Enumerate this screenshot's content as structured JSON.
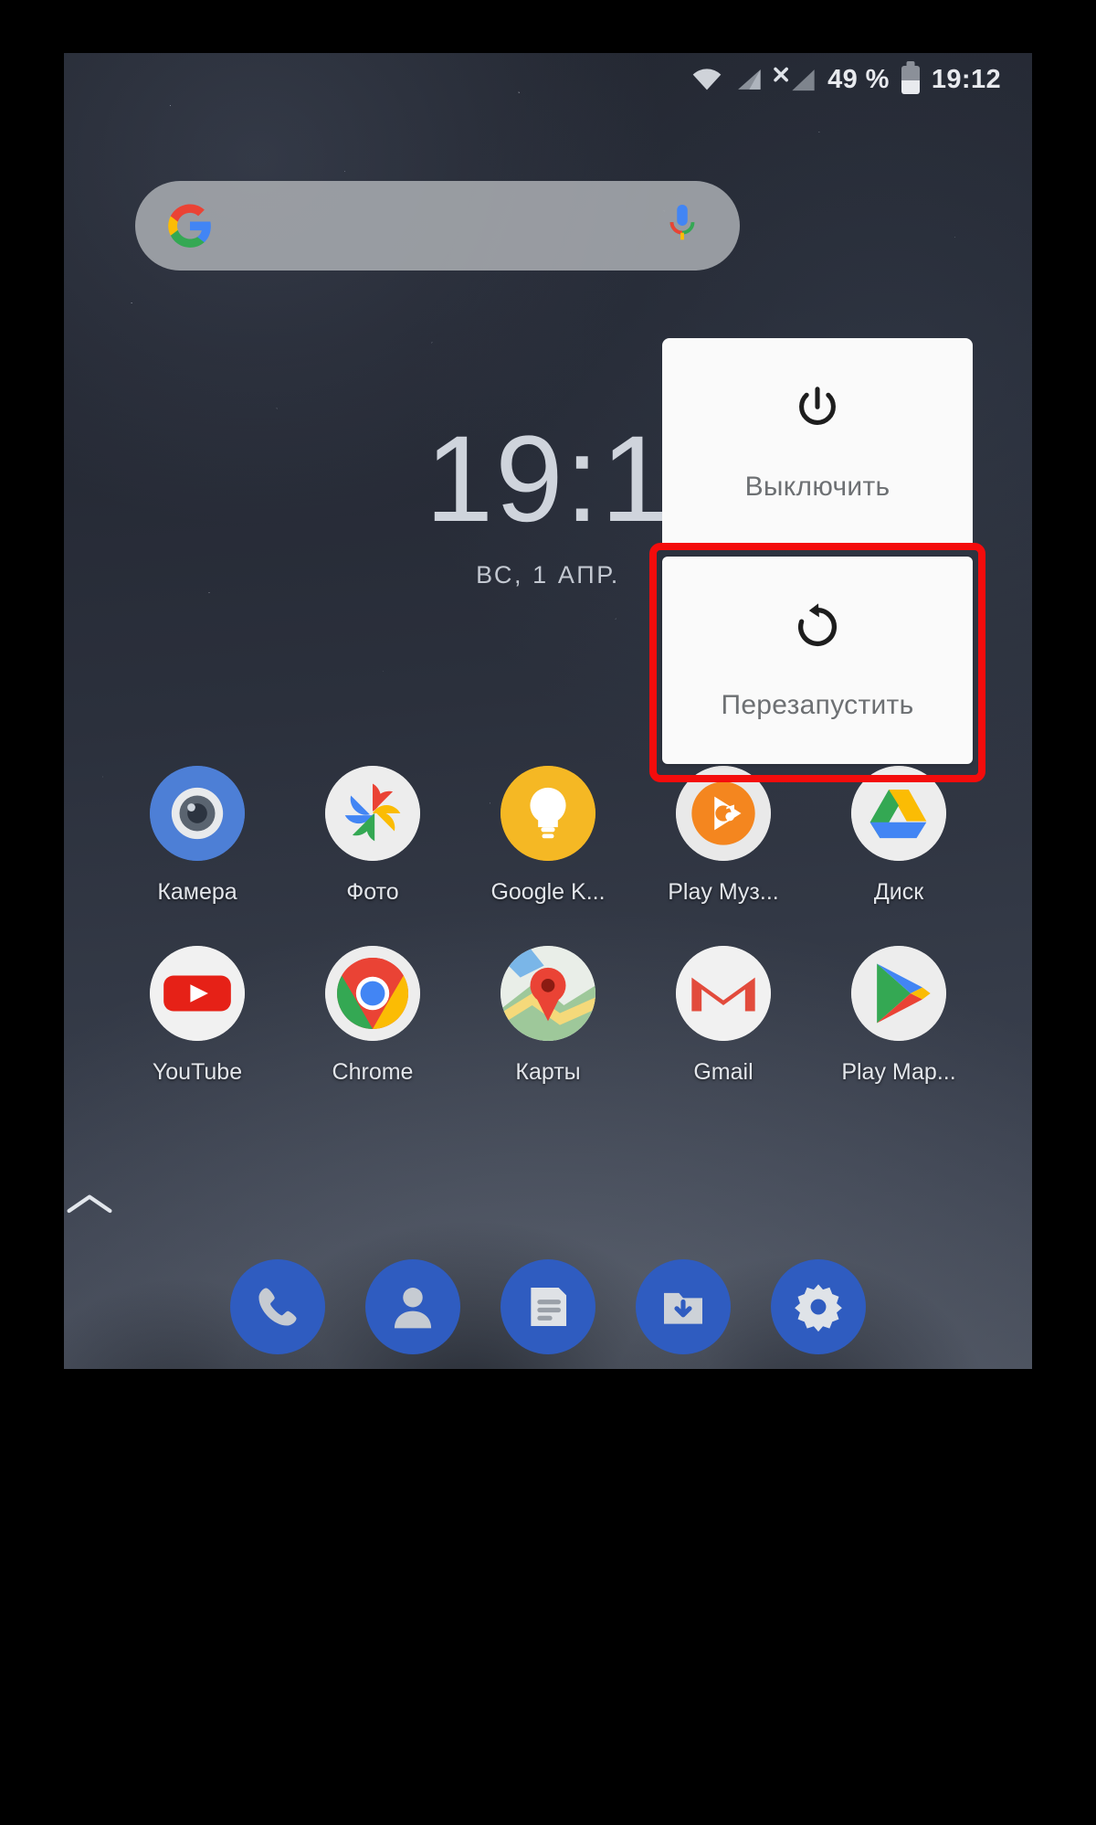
{
  "status_bar": {
    "wifi_icon": "wifi-icon",
    "signal1_icon": "signal-bars-icon",
    "no_sim_icon": "signal-no-service-icon",
    "battery_percent": "49 %",
    "battery_icon": "battery-half-icon",
    "time": "19:12"
  },
  "search": {
    "google_icon": "google-g-icon",
    "mic_icon": "microphone-icon",
    "placeholder": ""
  },
  "clock_widget": {
    "time": "19:1",
    "date": "ВС, 1 АПР."
  },
  "power_menu": {
    "items": [
      {
        "label": "Выключить",
        "icon": "power-icon",
        "highlighted": false
      },
      {
        "label": "Перезапустить",
        "icon": "restart-icon",
        "highlighted": true
      }
    ],
    "highlight_color": "#f40c0c"
  },
  "app_rows": [
    {
      "apps": [
        {
          "label": "Камера",
          "icon": "camera-icon"
        },
        {
          "label": "Фото",
          "icon": "google-photos-icon"
        },
        {
          "label": "Google K...",
          "icon": "google-keep-icon"
        },
        {
          "label": "Play Муз...",
          "icon": "play-music-icon"
        },
        {
          "label": "Диск",
          "icon": "google-drive-icon"
        }
      ]
    },
    {
      "apps": [
        {
          "label": "YouTube",
          "icon": "youtube-icon"
        },
        {
          "label": "Chrome",
          "icon": "chrome-icon"
        },
        {
          "label": "Карты",
          "icon": "google-maps-icon"
        },
        {
          "label": "Gmail",
          "icon": "gmail-icon"
        },
        {
          "label": "Play Мар...",
          "icon": "play-store-icon"
        }
      ]
    }
  ],
  "drawer": {
    "arrow_icon": "chevron-up-icon"
  },
  "dock": {
    "items": [
      {
        "name": "phone-icon"
      },
      {
        "name": "contacts-icon"
      },
      {
        "name": "messages-icon"
      },
      {
        "name": "files-downloads-icon"
      },
      {
        "name": "settings-gear-icon"
      }
    ],
    "background_color": "#2f5cc0"
  }
}
